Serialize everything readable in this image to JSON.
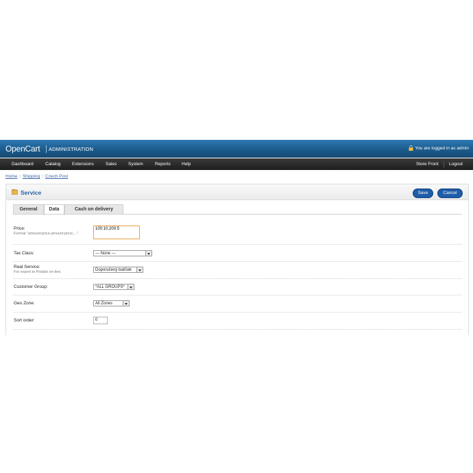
{
  "header": {
    "logo": "OpenCart",
    "subtitle": "ADMINISTRATION",
    "logged_in": "You are logged in as admin"
  },
  "menu": {
    "left": [
      "Dashboard",
      "Catalog",
      "Extensions",
      "Sales",
      "System",
      "Reports",
      "Help"
    ],
    "right": [
      "Store Front",
      "Logout"
    ]
  },
  "breadcrumb": {
    "items": [
      "Home",
      "Shipping",
      "Czech Post"
    ],
    "separator": "::"
  },
  "box": {
    "title": "Service",
    "save_label": "Save",
    "cancel_label": "Cancel"
  },
  "tabs": [
    "General",
    "Data",
    "Cash on delivery"
  ],
  "active_tab": "Data",
  "form": {
    "price": {
      "label": "Price:",
      "help": "Format \"amount:price,amount:price....\".",
      "value": "100:10,200:5"
    },
    "tax_class": {
      "label": "Tax Class:",
      "value": " --- None --- "
    },
    "real_service": {
      "label": "Real Service:",
      "help": "For export to Podání on-line.",
      "value": "Doporučený balíček"
    },
    "customer_group": {
      "label": "Customer Group:",
      "value": "*ALL GROUPS*"
    },
    "geo_zone": {
      "label": "Geo Zone:",
      "value": "All Zones"
    },
    "sort_order": {
      "label": "Sort order:",
      "value": "0"
    }
  },
  "colors": {
    "header": "#1b5b8c",
    "menu": "#2a2a2a",
    "button": "#1f5ca8",
    "title": "#2a5fa0",
    "focus": "#e1a64a"
  }
}
